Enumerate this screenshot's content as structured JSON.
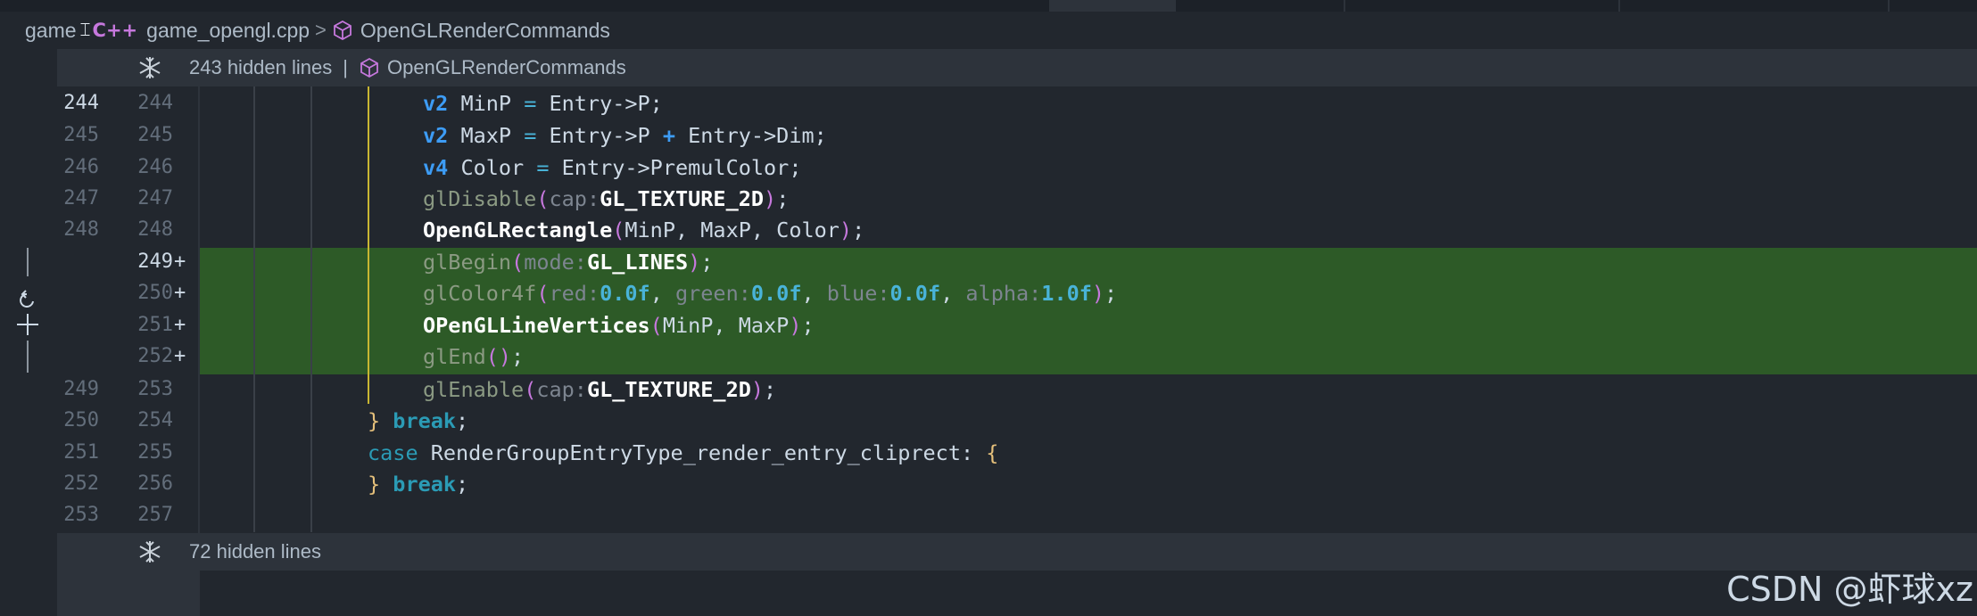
{
  "breadcrumb": {
    "root": "game",
    "file_icon": "C++",
    "file": "game_opengl.cpp",
    "symbol": "OpenGLRenderCommands"
  },
  "top_fold": {
    "text": "243 hidden lines",
    "separator": "|",
    "symbol": "OpenGLRenderCommands"
  },
  "bottom_fold": {
    "text": "72 hidden lines"
  },
  "gutter": {
    "old_numbers": [
      "244",
      "245",
      "246",
      "247",
      "248",
      "",
      "",
      "",
      "",
      "249",
      "250",
      "251",
      "252",
      "253"
    ],
    "new_numbers": [
      "244",
      "245",
      "246",
      "247",
      "248",
      "249",
      "250",
      "251",
      "252",
      "253",
      "254",
      "255",
      "256",
      "257"
    ],
    "added_marker": "+"
  },
  "code": {
    "l0": {
      "t1": "v2",
      "t2": " MinP ",
      "t3": "=",
      "t4": " Entry->P;"
    },
    "l1": {
      "t1": "v2",
      "t2": " MaxP ",
      "t3": "=",
      "t4": " Entry->P ",
      "t5": "+",
      "t6": " Entry->Dim;"
    },
    "l2": {
      "t1": "v4",
      "t2": " Color ",
      "t3": "=",
      "t4": " Entry->PremulColor;"
    },
    "l3": {
      "fn": "glDisable",
      "p1": "(",
      "hint": "cap:",
      "arg": "GL_TEXTURE_2D",
      "p2": ")",
      "end": ";"
    },
    "l4": {
      "fn": "OpenGLRectangle",
      "p1": "(",
      "args": "MinP, MaxP, Color",
      "p2": ")",
      "end": ";"
    },
    "l5": {
      "fn": "glBegin",
      "p1": "(",
      "hint": "mode:",
      "arg": "GL_LINES",
      "p2": ")",
      "end": ";"
    },
    "l6": {
      "fn": "glColor4f",
      "p1": "(",
      "h1": "red:",
      "n1": "0.0f",
      "c1": ", ",
      "h2": "green:",
      "n2": "0.0f",
      "c2": ", ",
      "h3": "blue:",
      "n3": "0.0f",
      "c3": ", ",
      "h4": "alpha:",
      "n4": "1.0f",
      "p2": ")",
      "end": ";"
    },
    "l7": {
      "fn": "OPenGLLineVertices",
      "p1": "(",
      "args": "MinP, MaxP",
      "p2": ")",
      "end": ";"
    },
    "l8": {
      "fn": "glEnd",
      "p1": "()",
      "end": ";"
    },
    "l9": {
      "fn": "glEnable",
      "p1": "(",
      "hint": "cap:",
      "arg": "GL_TEXTURE_2D",
      "p2": ")",
      "end": ";"
    },
    "l10": {
      "brace": "}",
      "kw": " break",
      "end": ";"
    },
    "l11": {
      "kw": "case",
      "label": " RenderGroupEntryType_render_entry_cliprect: ",
      "brace": "{"
    },
    "l12": {
      "brace": "}",
      "kw": " break",
      "end": ";"
    }
  },
  "watermark": "CSDN @虾球xz",
  "colors": {
    "added_line": "#2d5a27",
    "indent_guide_active": "#c8b632",
    "background": "#22272e"
  }
}
